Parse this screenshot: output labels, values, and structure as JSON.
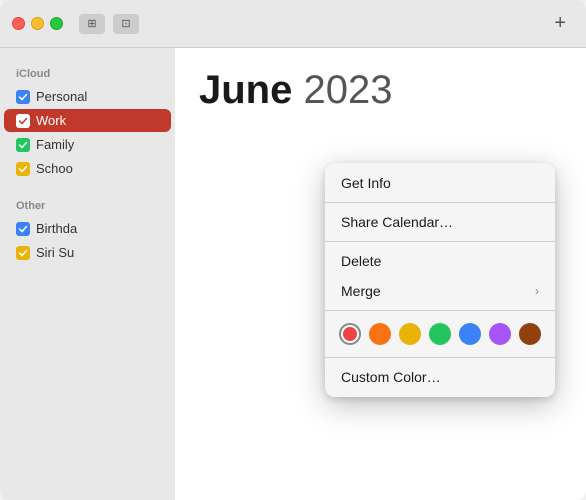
{
  "titlebar": {
    "add_label": "+",
    "icon_grid": "▦",
    "icon_inbox": "⊡"
  },
  "sidebar": {
    "icloud_label": "iCloud",
    "other_label": "Other",
    "items": [
      {
        "id": "personal",
        "label": "Personal",
        "color": "blue",
        "checked": true
      },
      {
        "id": "work",
        "label": "Work",
        "color": "red",
        "checked": true,
        "selected": true
      },
      {
        "id": "family",
        "label": "Family",
        "color": "green",
        "checked": true
      },
      {
        "id": "school",
        "label": "Schoo",
        "color": "yellow",
        "checked": true
      }
    ],
    "other_items": [
      {
        "id": "birthdays",
        "label": "Birthda",
        "color": "blue",
        "checked": true
      },
      {
        "id": "siri",
        "label": "Siri Su",
        "color": "yellow",
        "checked": true
      }
    ]
  },
  "content": {
    "month": "June",
    "year": "2023"
  },
  "context_menu": {
    "items": [
      {
        "id": "get-info",
        "label": "Get Info",
        "has_submenu": false
      },
      {
        "id": "share-calendar",
        "label": "Share Calendar…",
        "has_submenu": false
      },
      {
        "id": "delete",
        "label": "Delete",
        "has_submenu": false
      },
      {
        "id": "merge",
        "label": "Merge",
        "has_submenu": true
      }
    ],
    "custom_color_label": "Custom Color…",
    "colors": [
      {
        "id": "red",
        "class": "swatch-red",
        "selected": true
      },
      {
        "id": "orange",
        "class": "swatch-orange",
        "selected": false
      },
      {
        "id": "yellow",
        "class": "swatch-yellow",
        "selected": false
      },
      {
        "id": "green",
        "class": "swatch-green",
        "selected": false
      },
      {
        "id": "blue",
        "class": "swatch-blue",
        "selected": false
      },
      {
        "id": "purple",
        "class": "swatch-purple",
        "selected": false
      },
      {
        "id": "brown",
        "class": "swatch-brown",
        "selected": false
      }
    ]
  }
}
